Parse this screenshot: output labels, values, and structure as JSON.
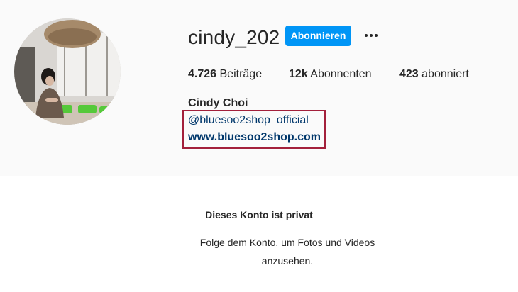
{
  "profile": {
    "username": "cindy_202",
    "follow_label": "Abonnieren",
    "more_icon": "more-horizontal-icon",
    "stats": {
      "posts_count": "4.726",
      "posts_label": "Beiträge",
      "followers_count": "12k",
      "followers_label": "Abonnenten",
      "following_count": "423",
      "following_label": "abonniert"
    },
    "full_name": "Cindy Choi",
    "bio_mention": "@bluesoo2shop_official",
    "website": "www.bluesoo2shop.com"
  },
  "private_notice": {
    "title": "Dieses Konto ist privat",
    "description": "Folge dem Konto, um Fotos und Videos anzusehen."
  },
  "colors": {
    "follow_button": "#0095f6",
    "link": "#00376b",
    "highlight_box": "#a3203b",
    "header_bg": "#fafafa"
  }
}
